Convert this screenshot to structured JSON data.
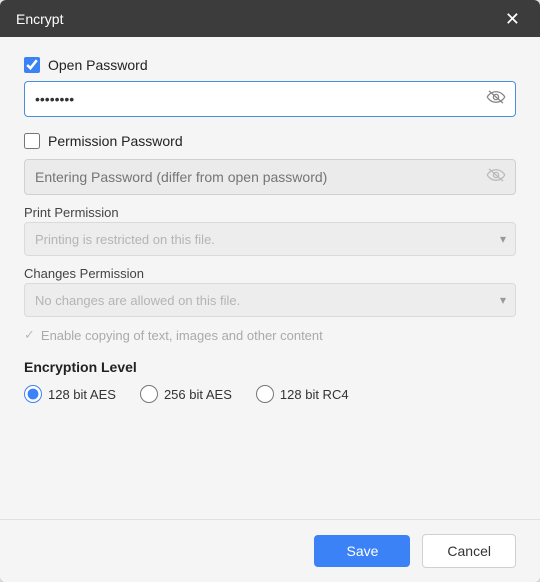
{
  "dialog": {
    "title": "Encrypt",
    "close_label": "✕"
  },
  "open_password": {
    "label": "Open Password",
    "checked": true,
    "value": "••••••••",
    "eye_icon": "👁"
  },
  "permission_password": {
    "label": "Permission Password",
    "checked": false,
    "placeholder": "Entering Password (differ from open password)"
  },
  "print_permission": {
    "label": "Print Permission",
    "placeholder": "Printing is restricted on this file."
  },
  "changes_permission": {
    "label": "Changes Permission",
    "placeholder": "No changes are allowed on this file."
  },
  "copy_content": {
    "label": "Enable copying of text, images and other content"
  },
  "encryption": {
    "title": "Encryption Level",
    "options": [
      {
        "label": "128 bit AES",
        "value": "128aes",
        "checked": true
      },
      {
        "label": "256 bit AES",
        "value": "256aes",
        "checked": false
      },
      {
        "label": "128 bit RC4",
        "value": "128rc4",
        "checked": false
      }
    ]
  },
  "footer": {
    "save_label": "Save",
    "cancel_label": "Cancel"
  }
}
